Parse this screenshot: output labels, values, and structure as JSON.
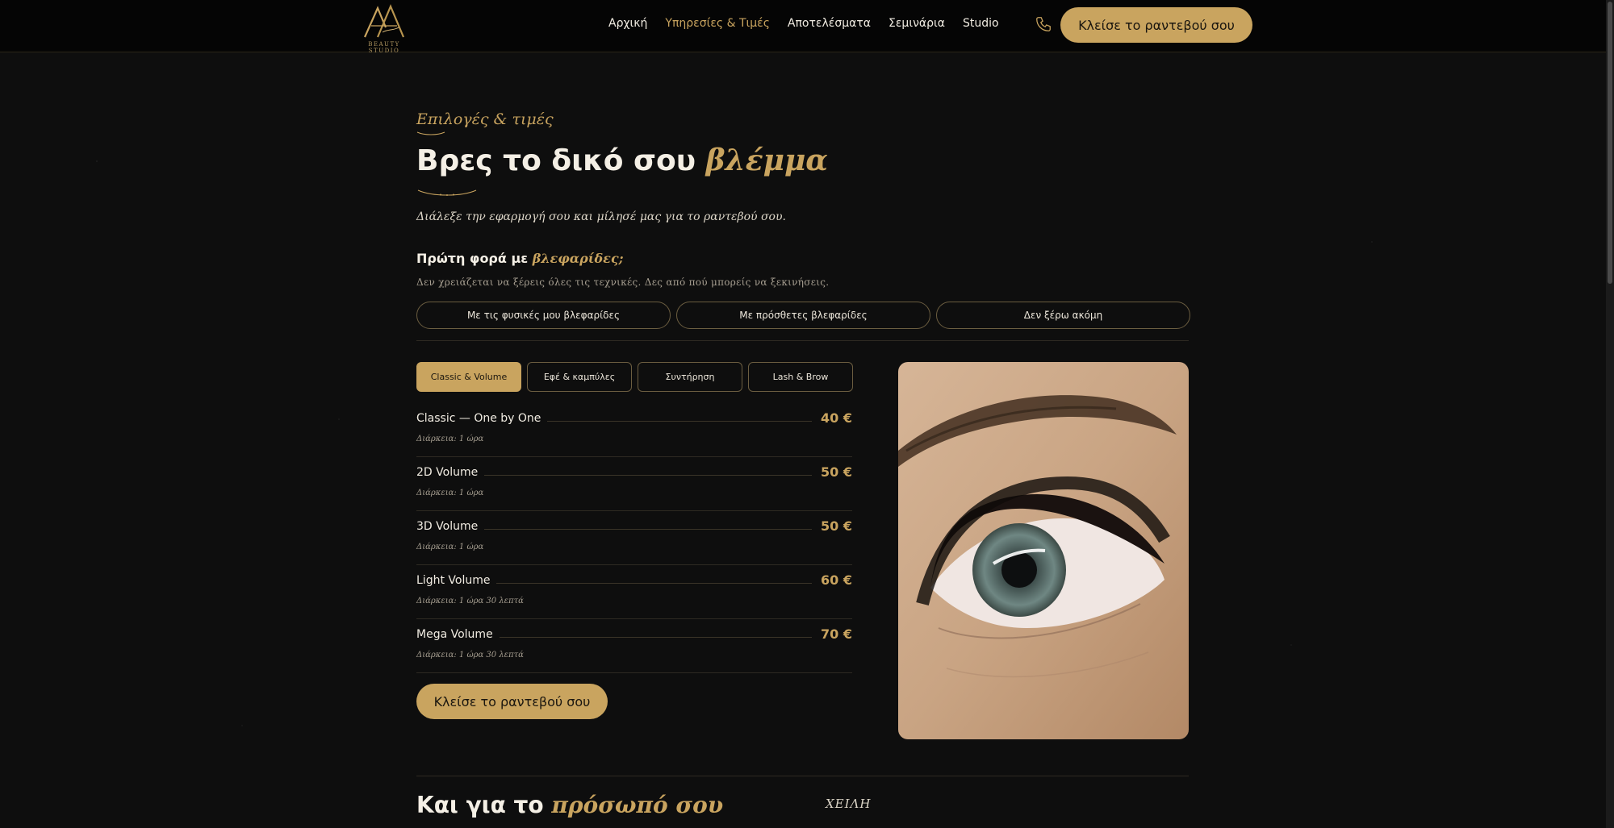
{
  "header": {
    "logo_sub": "BEAUTY STUDIO",
    "nav": [
      {
        "label": "Αρχική",
        "active": false
      },
      {
        "label": "Υπηρεσίες & Τιμές",
        "active": true
      },
      {
        "label": "Αποτελέσματα",
        "active": false
      },
      {
        "label": "Σεμινάρια",
        "active": false
      },
      {
        "label": "Studio",
        "active": false
      }
    ],
    "phone_icon": "phone-icon",
    "cta_label": "Κλείσε το ραντεβού σου"
  },
  "intro": {
    "eyebrow": "Επιλογές & τιμές",
    "title_main": "Βρες το δικό σου ",
    "title_accent": "βλέμμα",
    "subtitle": "Διάλεξε την εφαρμογή σου και μίλησέ μας για το ραντεβού σου."
  },
  "first_time": {
    "question_main": "Πρώτη φορά με ",
    "question_accent": "βλεφαρίδες;",
    "note": "Δεν χρειάζεται να ξέρεις όλες τις τεχνικές. Δες από πού μπορείς να ξεκινήσεις.",
    "options": [
      "Με τις φυσικές μου βλεφαρίδες",
      "Με πρόσθετες βλεφαρίδες",
      "Δεν ξέρω ακόμη"
    ]
  },
  "tabs": [
    {
      "label": "Classic & Volume",
      "active": true
    },
    {
      "label": "Εφέ & καμπύλες",
      "active": false
    },
    {
      "label": "Συντήρηση",
      "active": false
    },
    {
      "label": "Lash & Brow",
      "active": false
    }
  ],
  "prices": [
    {
      "name": "Classic — One by One",
      "price": "40 €",
      "duration": "Διάρκεια: 1 ώρα"
    },
    {
      "name": "2D Volume",
      "price": "50 €",
      "duration": "Διάρκεια: 1 ώρα"
    },
    {
      "name": "3D Volume",
      "price": "50 €",
      "duration": "Διάρκεια: 1 ώρα"
    },
    {
      "name": "Light Volume",
      "price": "60 €",
      "duration": "Διάρκεια: 1 ώρα 30 λεπτά"
    },
    {
      "name": "Mega Volume",
      "price": "70 €",
      "duration": "Διάρκεια: 1 ώρα 30 λεπτά"
    }
  ],
  "cta_label": "Κλείσε το ραντεβού σου",
  "next_section": {
    "title_main": "Και για το ",
    "title_accent": "πρόσωπό σου",
    "label": "ΧΕΙΛΗ"
  },
  "colors": {
    "background": "#0e0e0e",
    "gold": "#c9a45f",
    "text": "#f1ece2"
  }
}
